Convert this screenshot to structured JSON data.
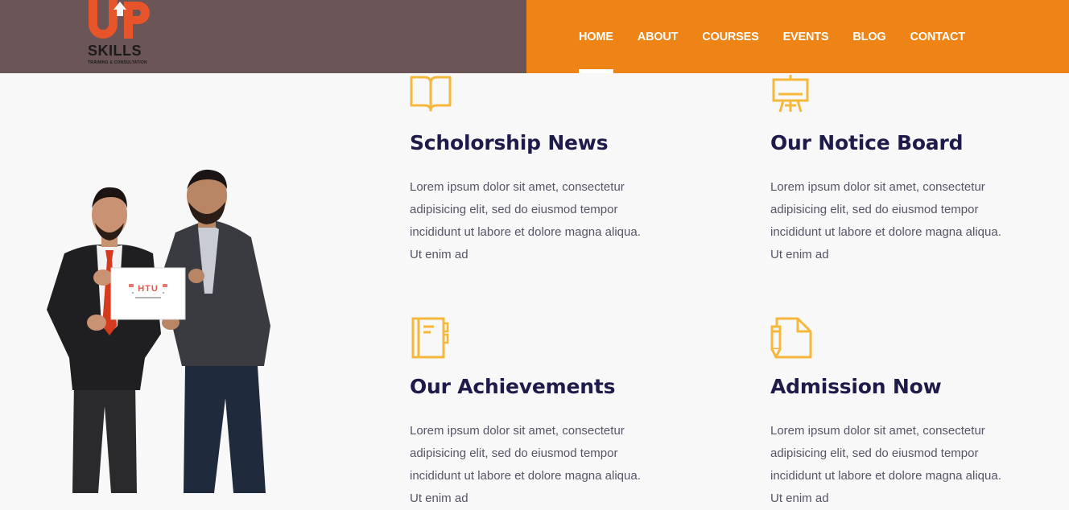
{
  "brand": {
    "logo_letters": "UP",
    "name": "SKILLS",
    "tagline": "TRAINING & CONSULTATION",
    "logo_color": "#e8542a",
    "header_left_color": "#6b5556",
    "header_right_color": "#ee8416"
  },
  "nav": {
    "items": [
      {
        "label": "HOME",
        "active": true
      },
      {
        "label": "ABOUT"
      },
      {
        "label": "COURSES"
      },
      {
        "label": "EVENTS"
      },
      {
        "label": "BLOG"
      },
      {
        "label": "CONTACT"
      }
    ]
  },
  "photo": {
    "card_text": "HTU"
  },
  "features": [
    {
      "icon": "open-book-icon",
      "title": "Scholorship News",
      "text": "Lorem ipsum dolor sit amet, consectetur adipisicing elit, sed do eiusmod tempor incididunt ut labore et dolore magna aliqua. Ut enim ad"
    },
    {
      "icon": "easel-board-icon",
      "title": "Our Notice Board",
      "text": "Lorem ipsum dolor sit amet, consectetur adipisicing elit, sed do eiusmod tempor incididunt ut labore et dolore magna aliqua. Ut enim ad"
    },
    {
      "icon": "notebook-icon",
      "title": "Our Achievements",
      "text": "Lorem ipsum dolor sit amet, consectetur adipisicing elit, sed do eiusmod tempor incididunt ut labore et dolore magna aliqua. Ut enim ad"
    },
    {
      "icon": "document-pencil-icon",
      "title": "Admission Now",
      "text": "Lorem ipsum dolor sit amet, consectetur adipisicing elit, sed do eiusmod tempor incididunt ut labore et dolore magna aliqua. Ut enim ad"
    }
  ],
  "colors": {
    "icon": "#f5b83d",
    "heading": "#1e1a4a",
    "body_text": "#555566"
  }
}
